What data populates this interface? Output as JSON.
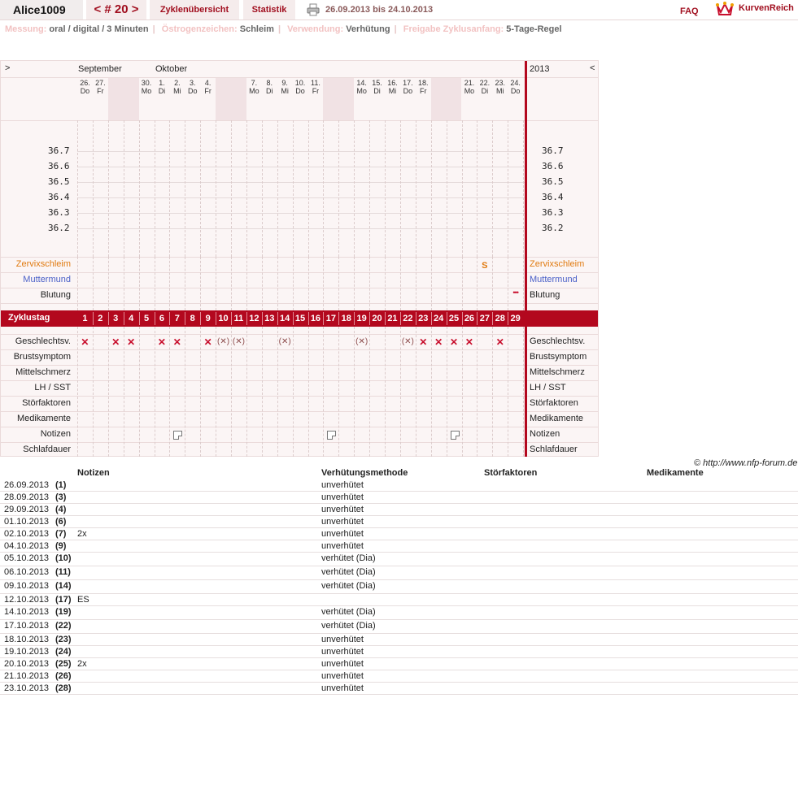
{
  "header": {
    "username": "Alice1009",
    "cycle_prev": "<",
    "cycle_label": "# 20",
    "cycle_next": ">",
    "tab_overview": "Zyklenübersicht",
    "tab_stats": "Statistik",
    "date_range": "26.09.2013 bis 24.10.2013",
    "faq": "FAQ",
    "logo_text": "KurvenReich"
  },
  "settings": [
    {
      "label": "Messung:",
      "value": "oral / digital / 3 Minuten"
    },
    {
      "label": "Östrogenzeichen:",
      "value": "Schleim"
    },
    {
      "label": "Verwendung:",
      "value": "Verhütung"
    },
    {
      "label": "Freigabe Zyklusanfang:",
      "value": "5-Tage-Regel"
    }
  ],
  "chart": {
    "nav_left": ">",
    "nav_right": "<",
    "month_sep": "September",
    "month_oct": "Oktober",
    "year": "2013",
    "days": [
      {
        "d": "26.",
        "w": "Do",
        "we": false
      },
      {
        "d": "27.",
        "w": "Fr",
        "we": false
      },
      {
        "d": "28.",
        "w": "Sa",
        "we": true
      },
      {
        "d": "29.",
        "w": "So",
        "we": true
      },
      {
        "d": "30.",
        "w": "Mo",
        "we": false
      },
      {
        "d": "1.",
        "w": "Di",
        "we": false
      },
      {
        "d": "2.",
        "w": "Mi",
        "we": false
      },
      {
        "d": "3.",
        "w": "Do",
        "we": false
      },
      {
        "d": "4.",
        "w": "Fr",
        "we": false
      },
      {
        "d": "5.",
        "w": "Sa",
        "we": true
      },
      {
        "d": "6.",
        "w": "So",
        "we": true
      },
      {
        "d": "7.",
        "w": "Mo",
        "we": false
      },
      {
        "d": "8.",
        "w": "Di",
        "we": false
      },
      {
        "d": "9.",
        "w": "Mi",
        "we": false
      },
      {
        "d": "10.",
        "w": "Do",
        "we": false
      },
      {
        "d": "11.",
        "w": "Fr",
        "we": false
      },
      {
        "d": "12.",
        "w": "Sa",
        "we": true
      },
      {
        "d": "13.",
        "w": "So",
        "we": true
      },
      {
        "d": "14.",
        "w": "Mo",
        "we": false
      },
      {
        "d": "15.",
        "w": "Di",
        "we": false
      },
      {
        "d": "16.",
        "w": "Mi",
        "we": false
      },
      {
        "d": "17.",
        "w": "Do",
        "we": false
      },
      {
        "d": "18.",
        "w": "Fr",
        "we": false
      },
      {
        "d": "19.",
        "w": "Sa",
        "we": true
      },
      {
        "d": "20.",
        "w": "So",
        "we": true
      },
      {
        "d": "21.",
        "w": "Mo",
        "we": false
      },
      {
        "d": "22.",
        "w": "Di",
        "we": false
      },
      {
        "d": "23.",
        "w": "Mi",
        "we": false
      },
      {
        "d": "24.",
        "w": "Do",
        "we": false
      }
    ],
    "temps": [
      "36.7",
      "36.6",
      "36.5",
      "36.4",
      "36.3",
      "36.2"
    ],
    "labels": {
      "zervix": "Zervixschleim",
      "muttermund": "Muttermund",
      "blutung": "Blutung",
      "zyklustag": "Zyklustag",
      "geschlecht": "Geschlechtsv.",
      "brust": "Brustsymptom",
      "mittel": "Mittelschmerz",
      "lh": "LH / SST",
      "stoer": "Störfaktoren",
      "medi": "Medikamente",
      "notizen": "Notizen",
      "schlaf": "Schlafdauer"
    },
    "zervix_marks": [
      {
        "day": 27,
        "text": "S"
      }
    ],
    "blutung_marks": [
      {
        "day": 29,
        "text": "•••"
      }
    ],
    "cycle_days": [
      "1",
      "2",
      "3",
      "4",
      "5",
      "6",
      "7",
      "8",
      "9",
      "10",
      "11",
      "12",
      "13",
      "14",
      "15",
      "16",
      "17",
      "18",
      "19",
      "20",
      "21",
      "22",
      "23",
      "24",
      "25",
      "26",
      "27",
      "28",
      "29"
    ],
    "intercourse": [
      {
        "day": 1,
        "type": "strong"
      },
      {
        "day": 3,
        "type": "strong"
      },
      {
        "day": 4,
        "type": "strong"
      },
      {
        "day": 6,
        "type": "strong"
      },
      {
        "day": 7,
        "type": "strong"
      },
      {
        "day": 9,
        "type": "strong"
      },
      {
        "day": 10,
        "type": "soft"
      },
      {
        "day": 11,
        "type": "soft"
      },
      {
        "day": 14,
        "type": "soft"
      },
      {
        "day": 19,
        "type": "soft"
      },
      {
        "day": 22,
        "type": "soft"
      },
      {
        "day": 23,
        "type": "strong"
      },
      {
        "day": 24,
        "type": "strong"
      },
      {
        "day": 25,
        "type": "strong"
      },
      {
        "day": 26,
        "type": "strong"
      },
      {
        "day": 28,
        "type": "strong"
      }
    ],
    "note_days": [
      7,
      17,
      25
    ]
  },
  "copyright": "© http://www.nfp-forum.de",
  "table": {
    "headers": {
      "notes": "Notizen",
      "method": "Verhütungsmethode",
      "stoer": "Störfaktoren",
      "medi": "Medikamente"
    },
    "rows": [
      {
        "date": "26.09.2013",
        "day": "(1)",
        "note": "",
        "method": "unverhütet"
      },
      {
        "date": "28.09.2013",
        "day": "(3)",
        "note": "",
        "method": "unverhütet"
      },
      {
        "date": "29.09.2013",
        "day": "(4)",
        "note": "",
        "method": "unverhütet"
      },
      {
        "date": "01.10.2013",
        "day": "(6)",
        "note": "",
        "method": "unverhütet"
      },
      {
        "date": "02.10.2013",
        "day": "(7)",
        "note": "2x",
        "method": "unverhütet"
      },
      {
        "date": "04.10.2013",
        "day": "(9)",
        "note": "",
        "method": "unverhütet"
      },
      {
        "date": "05.10.2013",
        "day": "(10)",
        "note": "",
        "method": "verhütet (Dia)"
      },
      {
        "date": "06.10.2013",
        "day": "(11)",
        "note": "",
        "method": "verhütet (Dia)"
      },
      {
        "date": "09.10.2013",
        "day": "(14)",
        "note": "",
        "method": "verhütet (Dia)"
      },
      {
        "date": "12.10.2013",
        "day": "(17)",
        "note": "ES",
        "method": ""
      },
      {
        "date": "14.10.2013",
        "day": "(19)",
        "note": "",
        "method": "verhütet (Dia)"
      },
      {
        "date": "17.10.2013",
        "day": "(22)",
        "note": "",
        "method": "verhütet (Dia)"
      },
      {
        "date": "18.10.2013",
        "day": "(23)",
        "note": "",
        "method": "unverhütet"
      },
      {
        "date": "19.10.2013",
        "day": "(24)",
        "note": "",
        "method": "unverhütet"
      },
      {
        "date": "20.10.2013",
        "day": "(25)",
        "note": "2x",
        "method": "unverhütet"
      },
      {
        "date": "21.10.2013",
        "day": "(26)",
        "note": "",
        "method": "unverhütet"
      },
      {
        "date": "23.10.2013",
        "day": "(28)",
        "note": "",
        "method": "unverhütet"
      }
    ]
  }
}
